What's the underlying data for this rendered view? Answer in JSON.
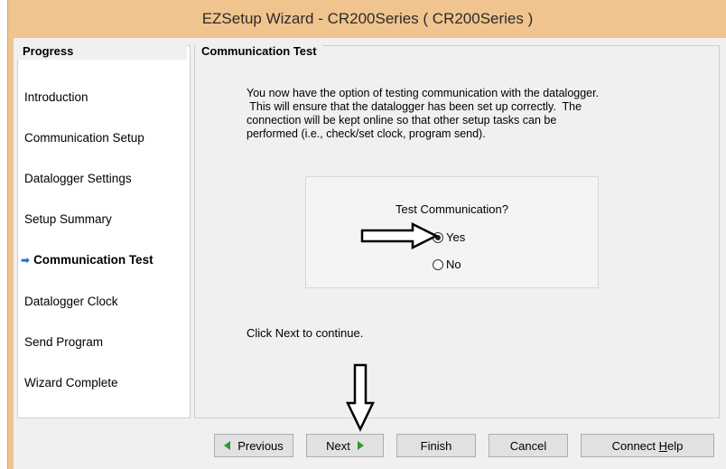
{
  "window": {
    "title": "EZSetup Wizard - CR200Series ( CR200Series )"
  },
  "progress": {
    "title": "Progress",
    "steps": [
      {
        "label": "Introduction"
      },
      {
        "label": "Communication Setup"
      },
      {
        "label": "Datalogger Settings"
      },
      {
        "label": "Setup Summary"
      },
      {
        "label": "Communication Test",
        "current": true
      },
      {
        "label": "Datalogger Clock"
      },
      {
        "label": "Send Program"
      },
      {
        "label": "Wizard Complete"
      }
    ],
    "current_icon": "current-step-arrow-icon"
  },
  "main": {
    "title": "Communication Test",
    "description_lines": [
      "You now have the option of testing communication with the datalogger.",
      " This will ensure that the datalogger has been set up correctly.  The",
      "connection will be kept online so that other setup tasks can be",
      "performed (i.e., check/set clock, program send)."
    ],
    "test_question": "Test Communication?",
    "options": [
      {
        "label": "Yes",
        "selected": true
      },
      {
        "label": "No",
        "selected": false
      }
    ],
    "footer_text": "Click Next to continue."
  },
  "buttons": {
    "previous": "Previous",
    "next": "Next",
    "finish": "Finish",
    "cancel": "Cancel",
    "connect_help_prefix": "Connect ",
    "connect_help_mnemonic": "H",
    "connect_help_suffix": "elp"
  },
  "colors": {
    "title_bar": "#f0c48e",
    "nav_arrow": "#2c6fd6",
    "button_arrow": "#2e9b2e"
  }
}
